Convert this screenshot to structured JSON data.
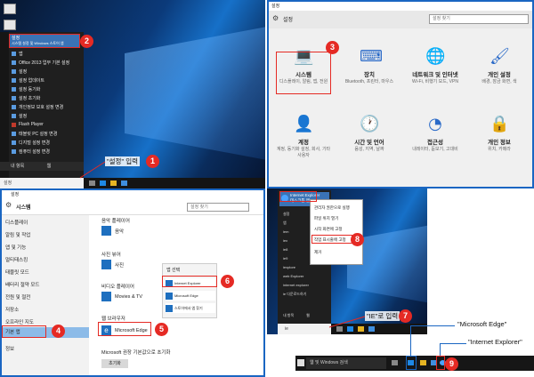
{
  "panel1": {
    "start_top_title": "설정",
    "start_top_sub": "시스템 설정 및 Windows 스토어 앱",
    "start_items": [
      "앱",
      "Office 2013 업무 기본 설정",
      "설정",
      "설정 업데이트",
      "설정 동기화",
      "설정 초기화",
      "개인정보 보호 설정 변경",
      "설정",
      "Flash Player",
      "태블릿 PC 설정 변경",
      "디지털 설정 변경",
      "컴퓨터 설정 변경"
    ],
    "search_section": "내 항목",
    "search_web": "웹",
    "search_box": "설정",
    "callout": "\"설정\" 입력",
    "badges": [
      "1",
      "2"
    ]
  },
  "panel2": {
    "window_title": "설정",
    "header_title": "설정",
    "search_placeholder": "설정 찾기",
    "badge": "3",
    "tiles": [
      {
        "icon": "laptop-icon",
        "name": "시스템",
        "desc": "디스플레이, 알림, 앱, 전원"
      },
      {
        "icon": "devices-icon",
        "name": "장치",
        "desc": "Bluetooth, 프린터, 마우스"
      },
      {
        "icon": "globe-icon",
        "name": "네트워크 및 인터넷",
        "desc": "Wi-Fi, 비행기 모드, VPN"
      },
      {
        "icon": "personalize-icon",
        "name": "개인 설정",
        "desc": "배경, 잠금 화면, 색"
      },
      {
        "icon": "person-icon",
        "name": "계정",
        "desc": "계정, 동기화 설정, 회사, 기타 사용자"
      },
      {
        "icon": "time-language-icon",
        "name": "시간 및 언어",
        "desc": "음성, 지역, 날짜"
      },
      {
        "icon": "ease-access-icon",
        "name": "접근성",
        "desc": "내레이터, 돋보기, 고대비"
      },
      {
        "icon": "lock-icon",
        "name": "개인 정보",
        "desc": "위치, 카메라"
      }
    ]
  },
  "panel3": {
    "window_title": "설정",
    "header_title": "시스템",
    "search_placeholder": "설정 찾기",
    "nav": [
      "디스플레이",
      "알림 및 작업",
      "앱 및 기능",
      "멀티태스킹",
      "태블릿 모드",
      "배터리 절약 모드",
      "전원 및 절전",
      "저장소",
      "오프라인 지도",
      "기본 앱",
      "정보"
    ],
    "sections": {
      "music": "음악 플레이어",
      "music_app": "음악",
      "photo": "사진 뷰어",
      "photo_app": "사진",
      "video": "비디오 플레이어",
      "video_app": "Movies & TV",
      "web": "웹 브라우저",
      "web_app": "Microsoft Edge",
      "reset_text": "Microsoft 권장 기본값으로 초기화",
      "reset_button": "초기화"
    },
    "chooser": {
      "title": "앱 선택",
      "options": [
        "Internet Explorer",
        "Microsoft Edge",
        "스토어에서 앱 찾기"
      ]
    },
    "badges": [
      "4",
      "5",
      "6"
    ]
  },
  "panel4": {
    "best_title": "Internet Explorer",
    "best_sub": "데스크톱 앱",
    "rows": [
      "설정",
      "앱",
      "iem",
      "iex",
      "ie8",
      "ie9",
      "iexplore",
      "web Explorer",
      "internet explorer",
      "ie 다운로드하기"
    ],
    "context_menu": [
      "관리자 권한으로 실행",
      "파일 위치 열기",
      "시작 화면에 고정",
      "작업 표시줄에 고정",
      "제거"
    ],
    "search_section": "내 항목",
    "search_web": "웹",
    "search_box": "ie",
    "callout": "\"IE\"로 입력",
    "badges": [
      "7",
      "8"
    ]
  },
  "panel5": {
    "search_text": "웹 및 Windows 검색",
    "label_edge": "\"Microsoft Edge\"",
    "label_ie": "\"Internet Explorer\"",
    "badge": "9"
  },
  "colors": {
    "badge_red": "#e52a24",
    "panel_border_blue": "#1a66c2",
    "settings_icon_blue": "#2a6ac8",
    "start_highlight": "#3a73b6"
  }
}
